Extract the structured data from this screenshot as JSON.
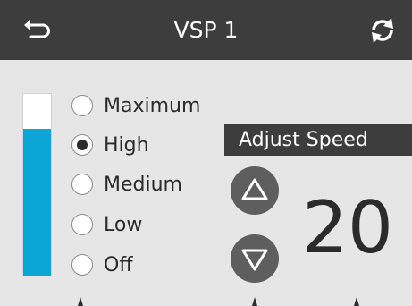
{
  "header": {
    "title": "VSP 1",
    "back_icon": "back-arrow-icon",
    "refresh_icon": "refresh-icon"
  },
  "speed_options": {
    "selected": "High",
    "items": [
      {
        "label": "Maximum",
        "checked": false
      },
      {
        "label": "High",
        "checked": true
      },
      {
        "label": "Medium",
        "checked": false
      },
      {
        "label": "Low",
        "checked": false
      },
      {
        "label": "Off",
        "checked": false
      }
    ]
  },
  "level_bar": {
    "fill_fraction": 0.81,
    "fill_color": "#0aa7d6"
  },
  "adjust": {
    "label": "Adjust Speed",
    "value": "20",
    "up_icon": "triangle-up-icon",
    "down_icon": "triangle-down-icon"
  },
  "colors": {
    "header_bg": "#3d3d3d",
    "page_bg": "#e6e6e6",
    "accent": "#0aa7d6",
    "button_bg": "#5e5e5e"
  }
}
